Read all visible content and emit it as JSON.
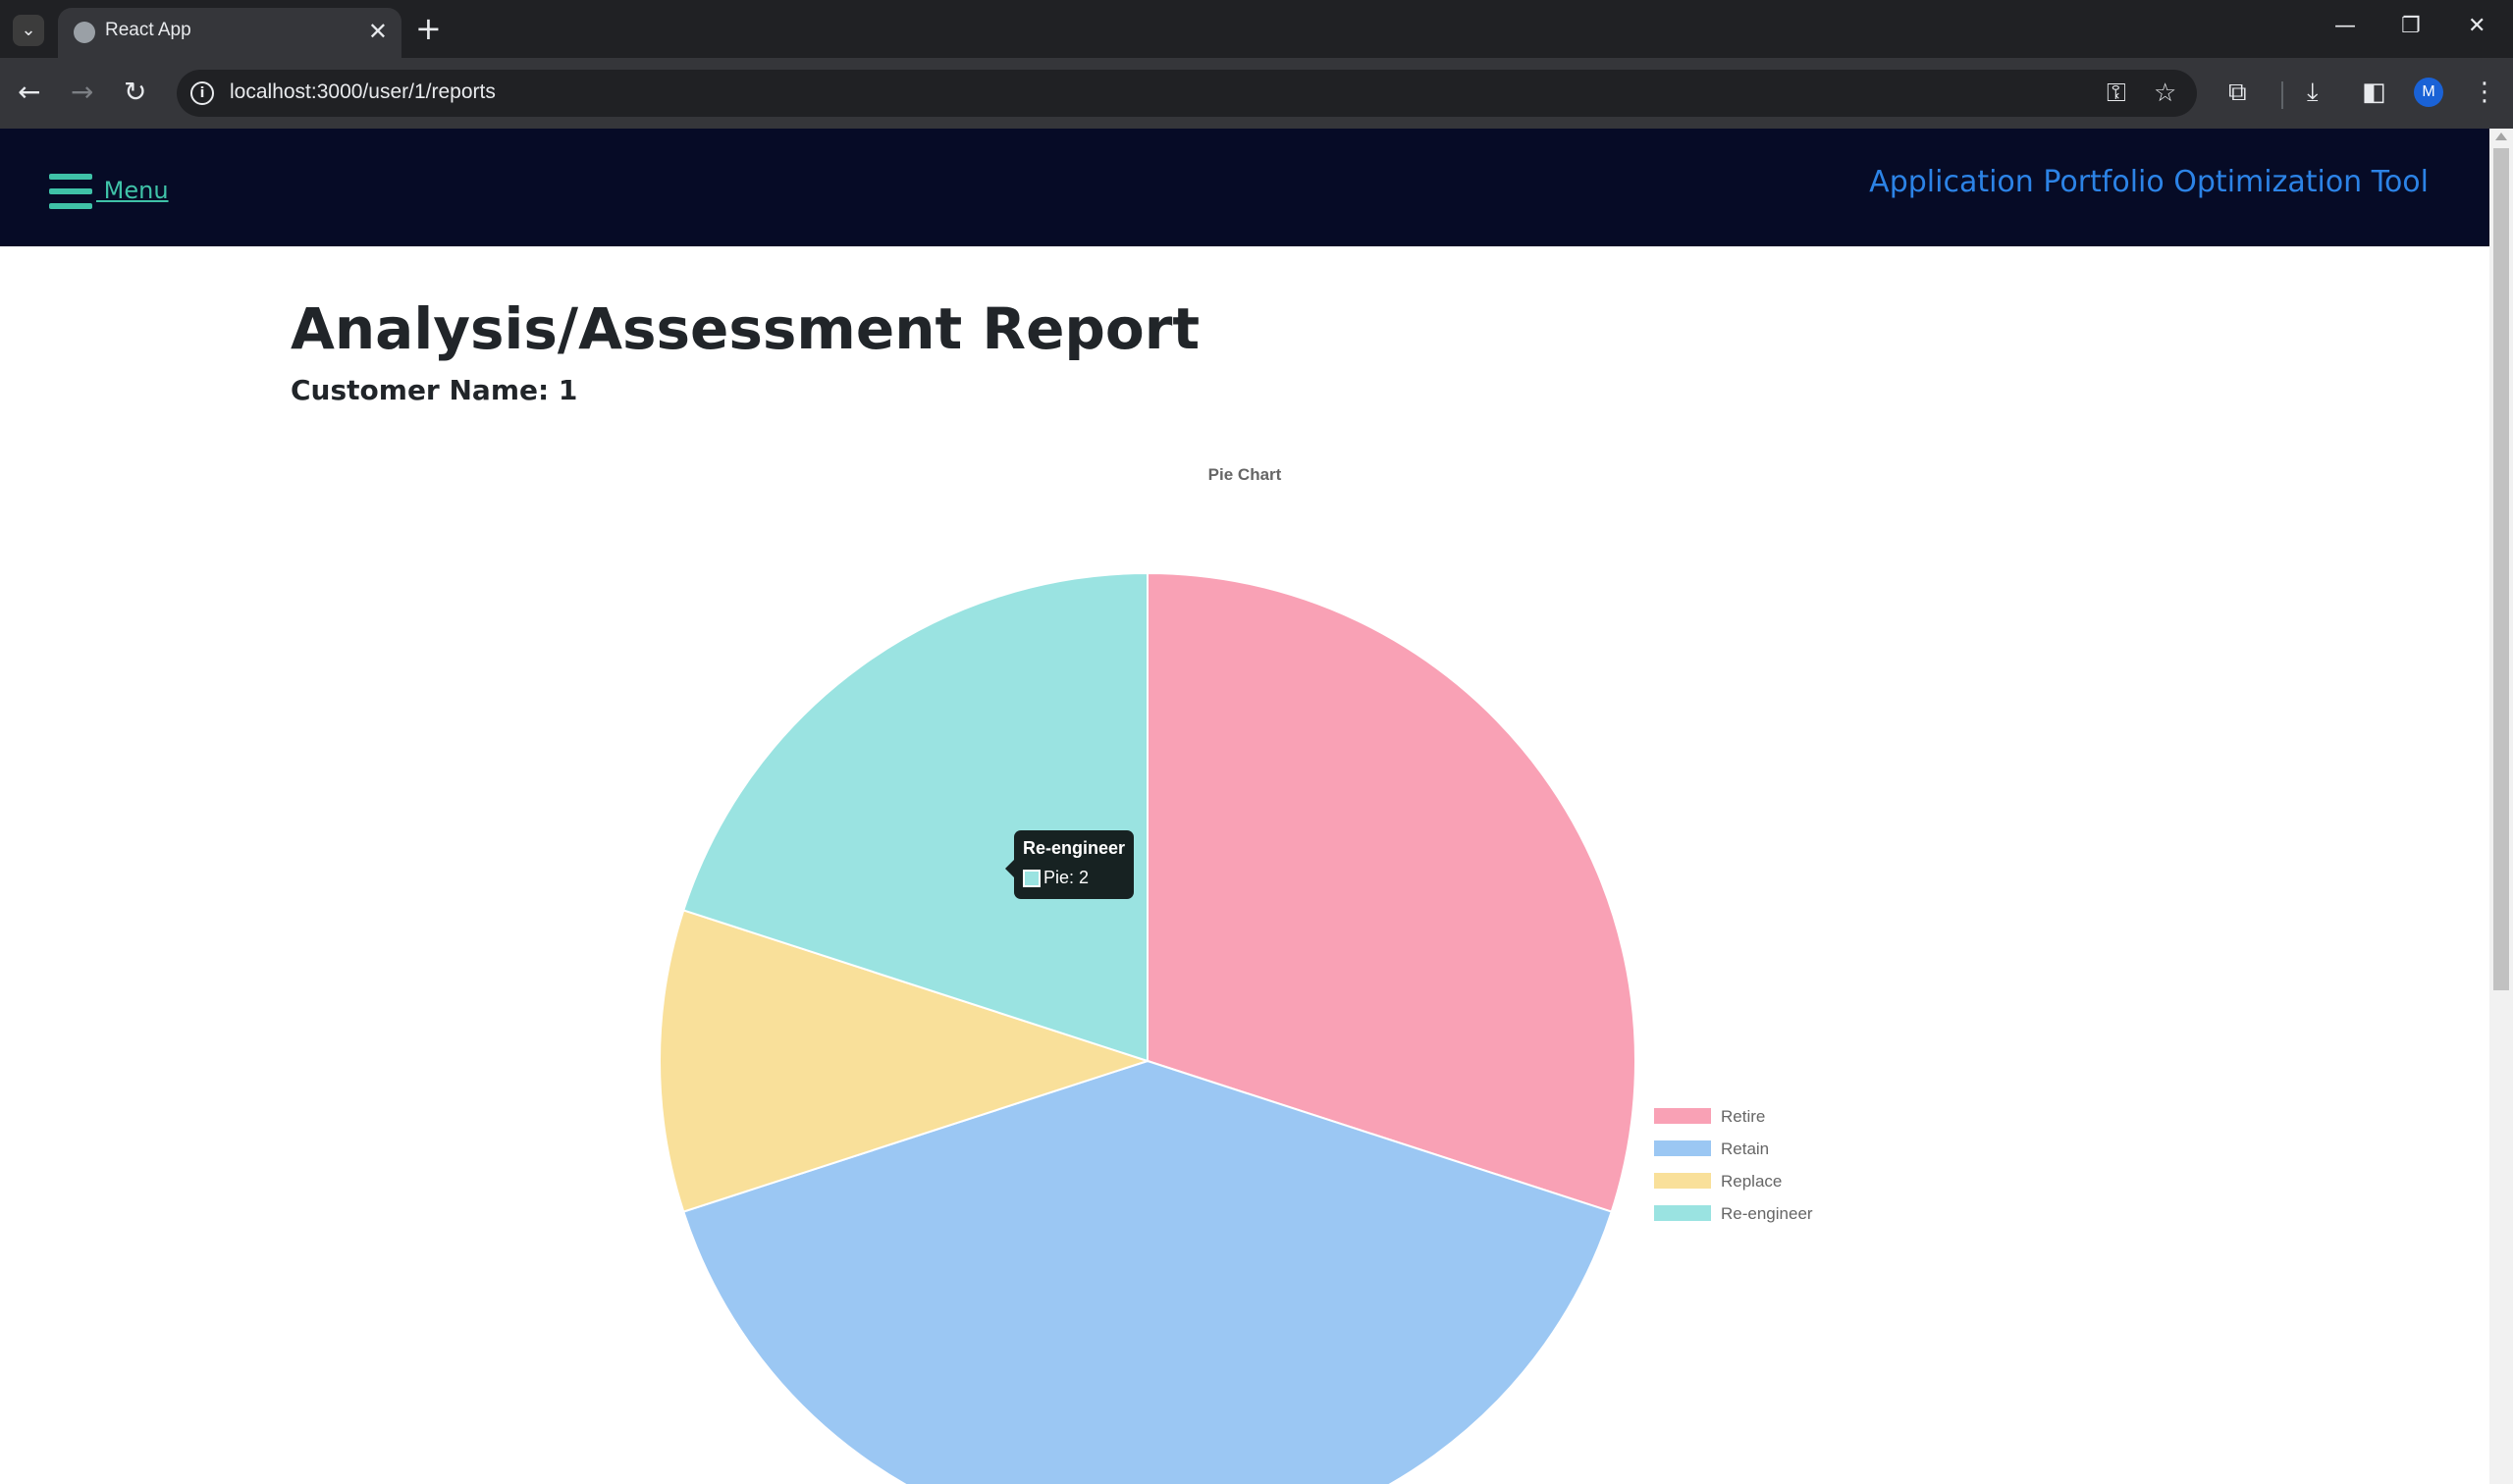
{
  "browser": {
    "tab_title": "React App",
    "url": "localhost:3000/user/1/reports"
  },
  "navbar": {
    "menu_label": " Menu",
    "app_title": "Application Portfolio Optimization Tool"
  },
  "page": {
    "title": "Analysis/Assessment Report",
    "customer": "Customer Name: 1"
  },
  "tooltip": {
    "title": "Re-engineer",
    "body": "Pie: 2"
  },
  "chart_data": {
    "type": "pie",
    "title": "Pie Chart",
    "categories": [
      "Retire",
      "Retain",
      "Replace",
      "Re-engineer"
    ],
    "series": [
      {
        "name": "Pie",
        "values": [
          3,
          4,
          1,
          2
        ]
      }
    ],
    "colors": [
      "#f9a1b5",
      "#9bc7f3",
      "#f9e09a",
      "#9ae3e1"
    ],
    "legend_position": "right"
  }
}
